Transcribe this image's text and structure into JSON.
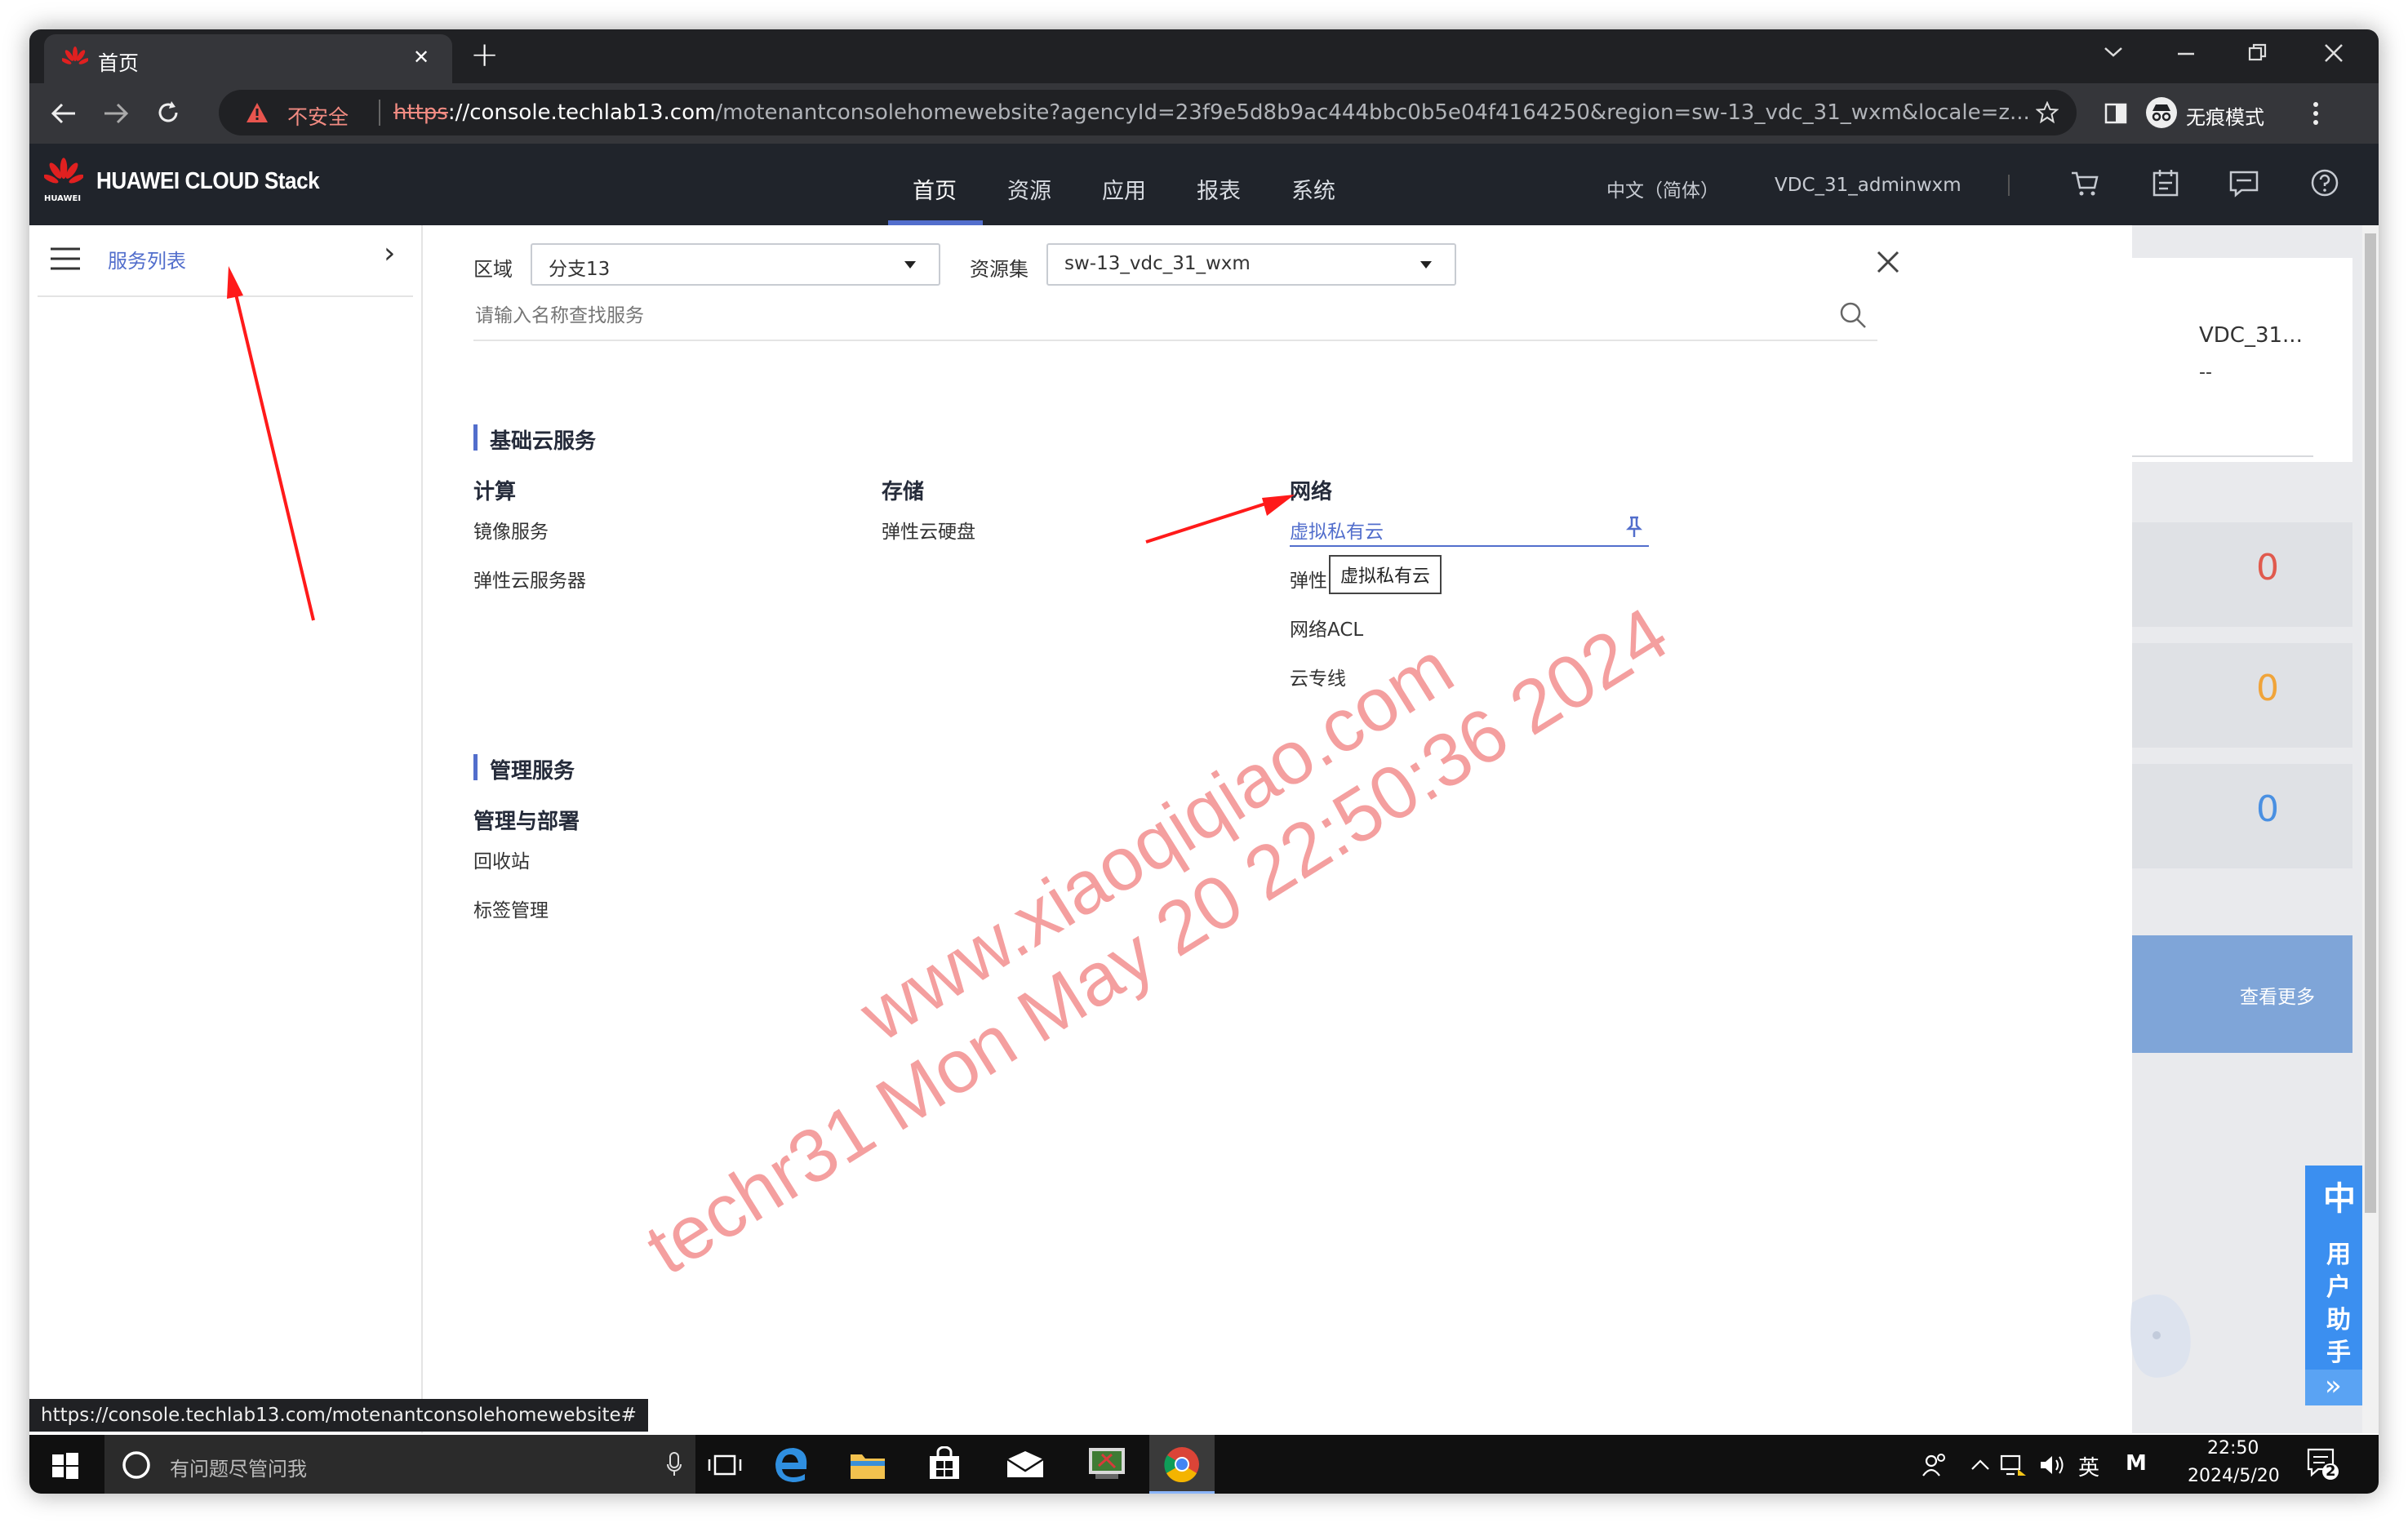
{
  "browser": {
    "tab_title": "首页",
    "tab_close": "✕",
    "new_tab": "+",
    "security_label": "不安全",
    "url_https": "https",
    "url_host": "://console.techlab13.com",
    "url_path": "/motenantconsolehomewebsite?agencyId=23f9e5d8b9ac444bbc0b5e04f4164250&region=sw-13_vdc_31_wxm&locale=z...",
    "incognito_label": "无痕模式",
    "status_url": "https://console.techlab13.com/motenantconsolehomewebsite#"
  },
  "app": {
    "brand_small": "HUAWEI",
    "brand": "HUAWEI CLOUD Stack",
    "nav": [
      "首页",
      "资源",
      "应用",
      "报表",
      "系统"
    ],
    "nav_active": 0,
    "language": "中文（简体）",
    "user": "VDC_31_adminwxm"
  },
  "sidebar": {
    "title": "服务列表",
    "expand": "›"
  },
  "panel": {
    "region_label": "区域",
    "region_value": "分支13",
    "resource_label": "资源集",
    "resource_value": "sw-13_vdc_31_wxm",
    "search_placeholder": "请输入名称查找服务",
    "groups": [
      {
        "title": "基础云服务",
        "columns": [
          {
            "title": "计算",
            "items": [
              "镜像服务",
              "弹性云服务器"
            ]
          },
          {
            "title": "存储",
            "items": [
              "弹性云硬盘"
            ]
          },
          {
            "title": "网络",
            "items": [
              "虚拟私有云",
              "弹性",
              "网络ACL",
              "云专线"
            ]
          }
        ]
      },
      {
        "title": "管理服务",
        "columns": [
          {
            "title": "管理与部署",
            "items": [
              "回收站",
              "标签管理"
            ]
          }
        ]
      }
    ],
    "tooltip": "虚拟私有云"
  },
  "background_page": {
    "vdc_name": "VDC_31...",
    "vdc_sub": "--",
    "counts": [
      "0",
      "0",
      "0"
    ],
    "count_colors": [
      "#e05a4e",
      "#f0a43a",
      "#4a90e2"
    ],
    "more_button": "查看更多",
    "assistant": [
      "中",
      "用",
      "户",
      "助",
      "手"
    ],
    "assistant_more": "»"
  },
  "watermark": {
    "line1": "www.xiaoqiqiao.com",
    "line2": "techr31 Mon May 20 22:50:36 2024"
  },
  "taskbar": {
    "search_placeholder": "有问题尽管问我",
    "ime": "英",
    "ime_m": "M",
    "time": "22:50",
    "date": "2024/5/20",
    "notification_count": "2"
  },
  "colors": {
    "accent": "#526ecc",
    "header_bg": "#20242b",
    "link_active": "#526ecc"
  }
}
